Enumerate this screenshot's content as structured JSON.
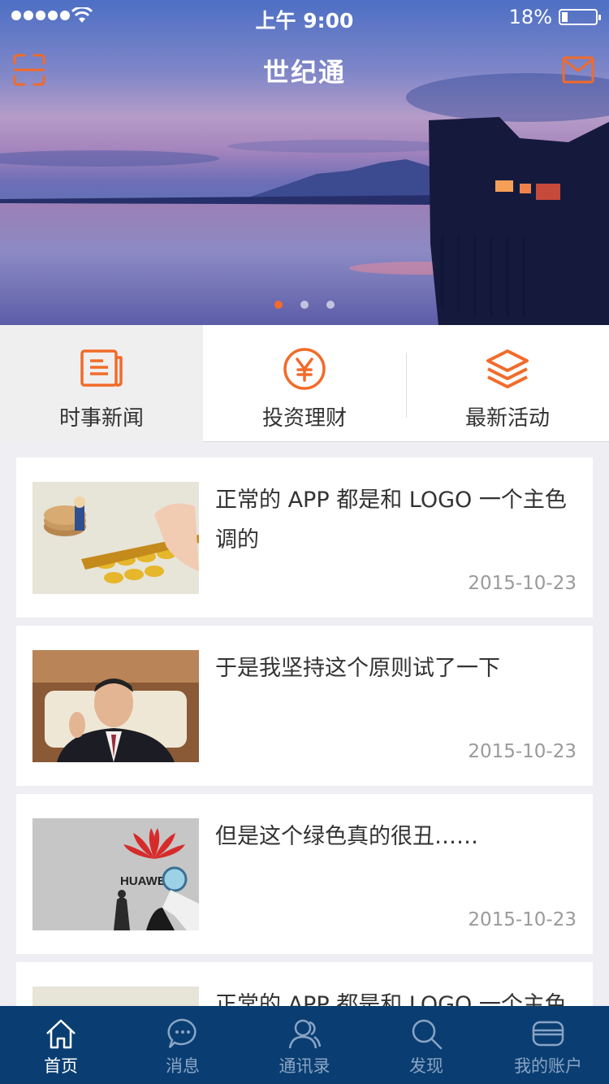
{
  "status_bar": {
    "time": "上午 9:00",
    "battery": "18%",
    "battery_level": 0.18
  },
  "header": {
    "title": "世纪通",
    "left_icon": "scan-icon",
    "right_icon": "mail-icon"
  },
  "carousel": {
    "slides": 3,
    "active_index": 0,
    "accent": "#f26b2a"
  },
  "categories": [
    {
      "label": "时事新闻",
      "icon": "news-icon",
      "active": true
    },
    {
      "label": "投资理财",
      "icon": "yuan-icon",
      "active": false
    },
    {
      "label": "最新活动",
      "icon": "layers-icon",
      "active": false
    }
  ],
  "news": [
    {
      "headline": "正常的 APP 都是和 LOGO 一个主色调的",
      "date": "2015-10-23"
    },
    {
      "headline": "于是我坚持这个原则试了一下",
      "date": "2015-10-23"
    },
    {
      "headline": "但是这个绿色真的很丑……",
      "date": "2015-10-23"
    },
    {
      "headline": "正常的 APP 都是和 LOGO 一个主色",
      "date": ""
    }
  ],
  "news_images": {
    "card3_logo_text": "HUAWEI"
  },
  "tabbar": {
    "background": "#0a3e72",
    "items": [
      {
        "label": "首页",
        "icon": "home-icon",
        "active": true
      },
      {
        "label": "消息",
        "icon": "chat-icon",
        "active": false
      },
      {
        "label": "通讯录",
        "icon": "contacts-icon",
        "active": false
      },
      {
        "label": "发现",
        "icon": "search-icon",
        "active": false
      },
      {
        "label": "我的账户",
        "icon": "card-icon",
        "active": false
      }
    ]
  }
}
